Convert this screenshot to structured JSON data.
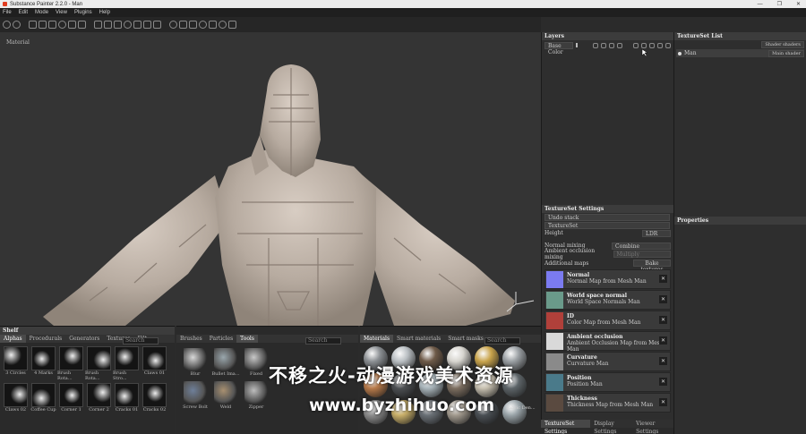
{
  "window": {
    "title": "Substance Painter 2.2.0 - Man",
    "controls": [
      "—",
      "❐",
      "✕"
    ]
  },
  "menu": [
    "File",
    "Edit",
    "Mode",
    "View",
    "Plugins",
    "Help"
  ],
  "viewport": {
    "mode_label": "Material"
  },
  "layers": {
    "title": "Layers",
    "channel": "Base Color"
  },
  "textureset_list": {
    "title": "TextureSet List",
    "shader_button": "Shader shaders",
    "item": "Man",
    "item_shader": "Main shader"
  },
  "textureset_settings": {
    "title": "TextureSet Settings",
    "undo_stack": "Undo stack",
    "textureset": "TextureSet",
    "height_label": "Height",
    "height_value": "LDR",
    "normal_mixing_label": "Normal mixing",
    "normal_mixing_value": "Combine",
    "ao_mixing_label": "Ambient occlusion mixing",
    "ao_mixing_value": "Multiply",
    "additional_maps_label": "Additional maps",
    "bake_button": "Bake textures",
    "maps": [
      {
        "name": "Normal",
        "desc": "Normal Map from Mesh Man",
        "color": "#7b7bf0"
      },
      {
        "name": "World space normal",
        "desc": "World Space Normals Man",
        "color": "#6a9a8a"
      },
      {
        "name": "ID",
        "desc": "Color Map from Mesh Man",
        "color": "#b0403a"
      },
      {
        "name": "Ambient occlusion",
        "desc": "Ambient Occlusion Map from Mesh Man",
        "color": "#d9d9d9"
      },
      {
        "name": "Curvature",
        "desc": "Curvature Man",
        "color": "#8a8a8a"
      },
      {
        "name": "Position",
        "desc": "Position Man",
        "color": "#4a7a8a"
      },
      {
        "name": "Thickness",
        "desc": "Thickness Map from Mesh Man",
        "color": "#5a4a40"
      }
    ]
  },
  "properties": {
    "title": "Properties"
  },
  "bottom_tabs": [
    "TextureSet Settings",
    "Display Settings",
    "Viewer Settings"
  ],
  "shelf": {
    "title": "Shelf",
    "tabs": [
      "Alphas",
      "Procedurals",
      "Generators",
      "Textures",
      "Filt"
    ],
    "search_placeholder": "Search",
    "items": [
      "3 Circles",
      "4 Marks",
      "Brush Rota...",
      "Brush Rota...",
      "Brush Stro...",
      "Claws 01",
      "Claws 02",
      "Coffee Cup",
      "Corner 1",
      "Corner 2",
      "Cracks 01",
      "Cracks 02"
    ]
  },
  "tools": {
    "tabs": [
      "Brushes",
      "Particles",
      "Tools"
    ],
    "search_placeholder": "Search",
    "items": [
      "Blur",
      "Bullet Ima...",
      "Fixed",
      "Screw Bolt",
      "Weld",
      "Zipper"
    ]
  },
  "materials": {
    "tabs": [
      "Materials",
      "Smart materials",
      "Smart masks"
    ],
    "search_placeholder": "Search",
    "visible_label": "Fabric Den..."
  },
  "watermark": {
    "line1": "不移之火-动漫游戏美术资源",
    "line2": "www.byzhihuo.com"
  }
}
